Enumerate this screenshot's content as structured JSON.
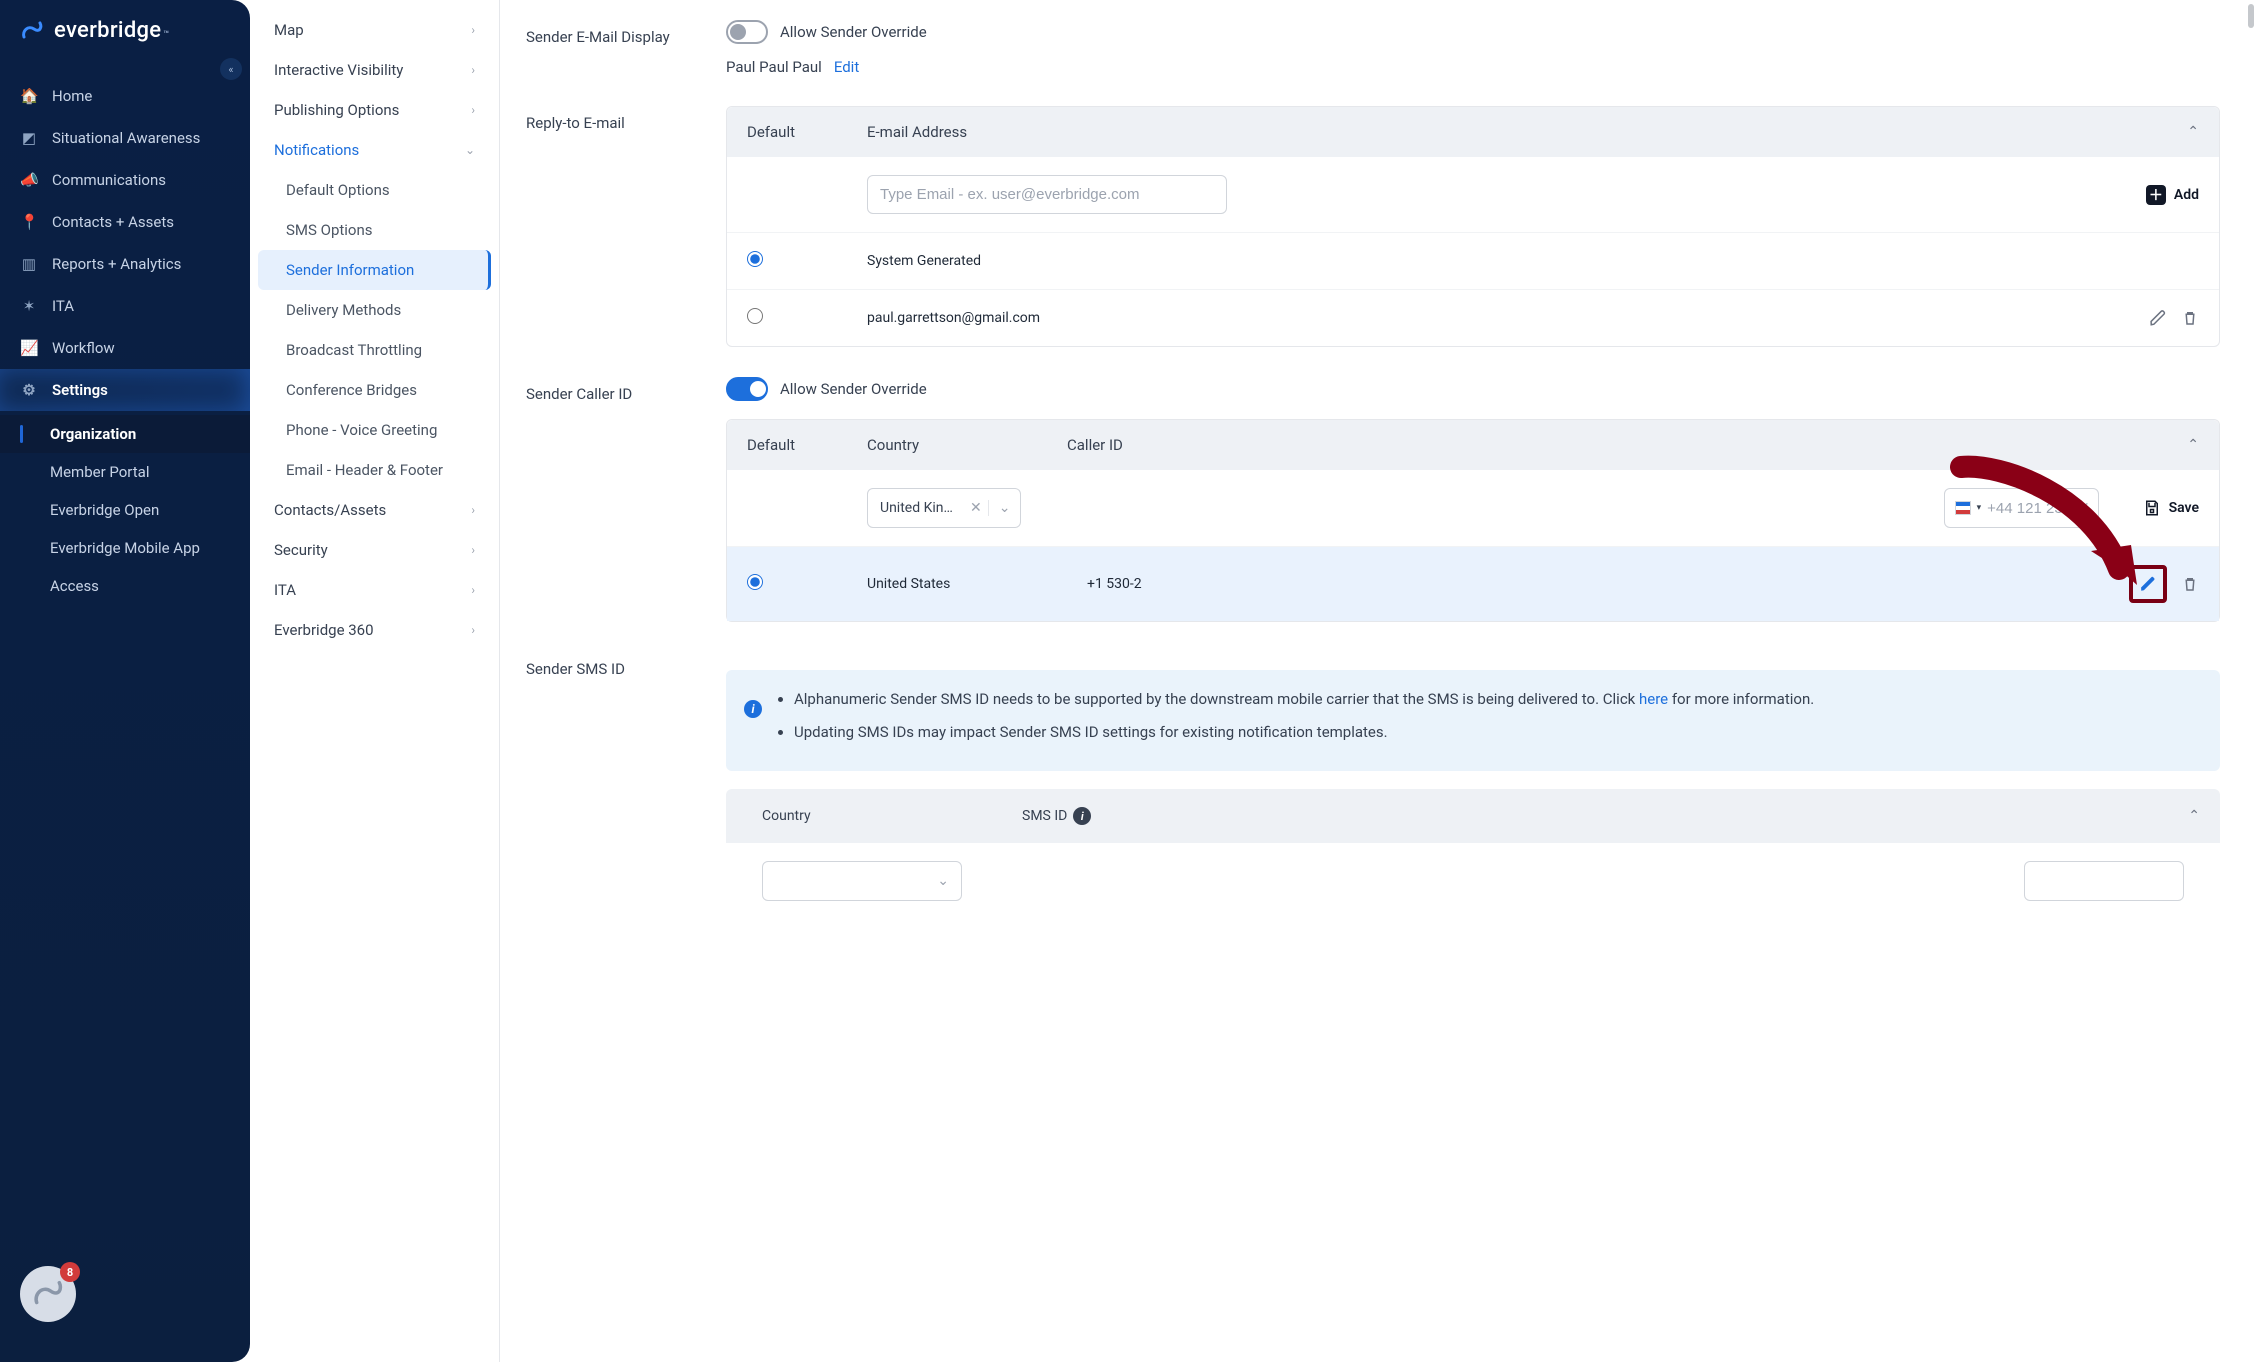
{
  "brand": {
    "name": "everbridge",
    "tm": "™"
  },
  "sidebar": {
    "items": [
      {
        "icon": "home",
        "label": "Home"
      },
      {
        "icon": "awareness",
        "label": "Situational Awareness"
      },
      {
        "icon": "megaphone",
        "label": "Communications"
      },
      {
        "icon": "pin",
        "label": "Contacts + Assets"
      },
      {
        "icon": "bar",
        "label": "Reports + Analytics"
      },
      {
        "icon": "nodes",
        "label": "ITA"
      },
      {
        "icon": "line",
        "label": "Workflow"
      },
      {
        "icon": "gear",
        "label": "Settings"
      }
    ],
    "sub": [
      {
        "label": "Organization",
        "active": true
      },
      {
        "label": "Member Portal"
      },
      {
        "label": "Everbridge Open"
      },
      {
        "label": "Everbridge Mobile App"
      },
      {
        "label": "Access"
      }
    ],
    "badge_count": "8"
  },
  "tree": {
    "items": [
      {
        "label": "Map",
        "type": "parent"
      },
      {
        "label": "Interactive Visibility",
        "type": "parent"
      },
      {
        "label": "Publishing Options",
        "type": "parent"
      },
      {
        "label": "Notifications",
        "type": "expanded",
        "children": [
          {
            "label": "Default Options"
          },
          {
            "label": "SMS Options"
          },
          {
            "label": "Sender Information",
            "active": true
          },
          {
            "label": "Delivery Methods"
          },
          {
            "label": "Broadcast Throttling"
          },
          {
            "label": "Conference Bridges"
          },
          {
            "label": "Phone - Voice Greeting"
          },
          {
            "label": "Email - Header & Footer"
          }
        ]
      },
      {
        "label": "Contacts/Assets",
        "type": "parent"
      },
      {
        "label": "Security",
        "type": "parent"
      },
      {
        "label": "ITA",
        "type": "parent"
      },
      {
        "label": "Everbridge 360",
        "type": "parent"
      }
    ]
  },
  "content": {
    "sender_email_display_label": "Sender E-Mail Display",
    "allow_override_email_label": "Allow Sender Override",
    "override_email_on": false,
    "sender_name": "Paul Paul Paul",
    "edit_link": "Edit",
    "reply_to_label": "Reply-to E-mail",
    "reply_cols": {
      "default": "Default",
      "email": "E-mail Address"
    },
    "email_placeholder": "Type Email - ex. user@everbridge.com",
    "add_label": "Add",
    "reply_rows": [
      {
        "selected": true,
        "email": "System Generated",
        "editable": false
      },
      {
        "selected": false,
        "email": "paul.garrettson@gmail.com",
        "editable": true
      }
    ],
    "caller_id_label": "Sender Caller ID",
    "allow_override_caller_label": "Allow Sender Override",
    "override_caller_on": true,
    "caller_cols": {
      "default": "Default",
      "country": "Country",
      "caller": "Caller ID"
    },
    "country_value": "United King…",
    "phone_placeholder": "+44 121 234 567",
    "save_label": "Save",
    "caller_rows": [
      {
        "selected": true,
        "country": "United States",
        "caller": "+1 530-2"
      }
    ],
    "sms_label": "Sender SMS ID",
    "info_bullets": [
      {
        "pre": "Alphanumeric Sender SMS ID needs to be supported by the downstream mobile carrier that the SMS is being delivered to. Click ",
        "link": "here",
        "post": " for more information."
      },
      {
        "pre": "Updating SMS IDs may impact Sender SMS ID settings for existing notification templates.",
        "link": "",
        "post": ""
      }
    ],
    "sms_cols": {
      "country": "Country",
      "smsid": "SMS ID"
    }
  }
}
